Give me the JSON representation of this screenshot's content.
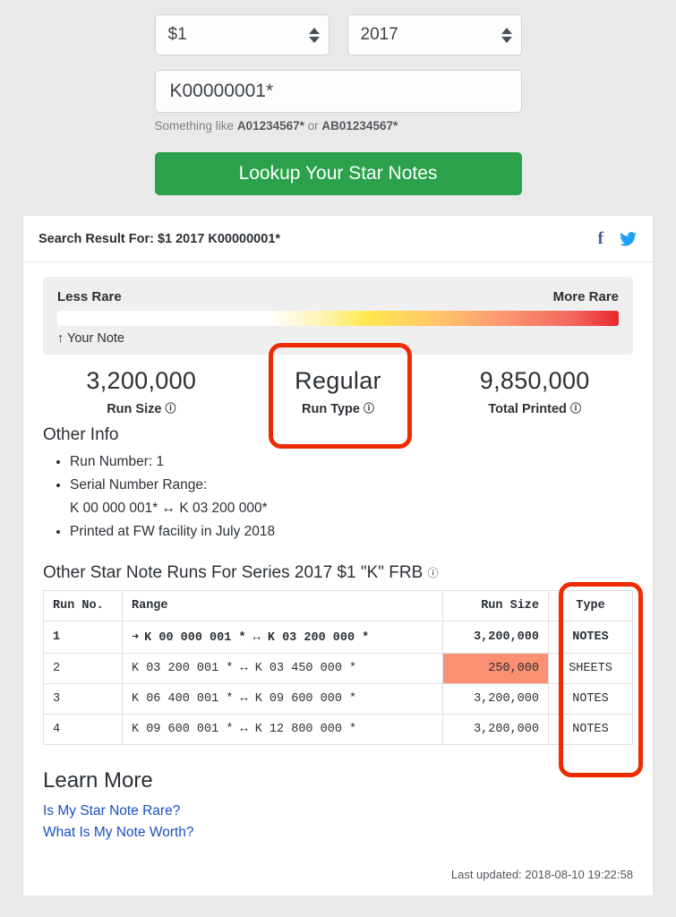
{
  "form": {
    "denomination": "$1",
    "series": "2017",
    "serial_value": "K00000001*",
    "serial_placeholder": "K00000001*",
    "hint_prefix": "Something like ",
    "hint_example_1": "A01234567*",
    "hint_middle": " or ",
    "hint_example_2": "AB01234567*",
    "lookup_label": "Lookup Your Star Notes"
  },
  "result": {
    "header": "Search Result For: $1 2017 K00000001*",
    "facebook_icon": "f",
    "twitter_icon": "ᵕ",
    "meter": {
      "left_label": "Less Rare",
      "right_label": "More Rare",
      "your_note": "↑ Your Note"
    },
    "stats": [
      {
        "value": "3,200,000",
        "label": "Run Size",
        "help": "?"
      },
      {
        "value": "Regular",
        "label": "Run Type",
        "help": "?"
      },
      {
        "value": "9,850,000",
        "label": "Total Printed",
        "help": "?"
      }
    ],
    "other_info": {
      "title": "Other Info",
      "items": [
        "Run Number: 1",
        "Serial Number Range:",
        "K 00 000 001* ↔ K 03 200 000*",
        "Printed at FW facility in July 2018"
      ]
    },
    "table": {
      "title": "Other Star Note Runs For Series 2017 $1 \"K\" FRB",
      "title_help": "?",
      "columns": [
        "Run No.",
        "Range",
        "Run Size",
        "Type"
      ],
      "rows": [
        {
          "run_no": "1",
          "arrow": "➜",
          "range": "K 00 000 001 * ↔ K 03 200 000 *",
          "run_size": "3,200,000",
          "type": "NOTES",
          "current": true,
          "highlight": false
        },
        {
          "run_no": "2",
          "arrow": "",
          "range": "K 03 200 001 * ↔ K 03 450 000 *",
          "run_size": "250,000",
          "type": "SHEETS",
          "current": false,
          "highlight": true
        },
        {
          "run_no": "3",
          "arrow": "",
          "range": "K 06 400 001 * ↔ K 09 600 000 *",
          "run_size": "3,200,000",
          "type": "NOTES",
          "current": false,
          "highlight": false
        },
        {
          "run_no": "4",
          "arrow": "",
          "range": "K 09 600 001 * ↔ K 12 800 000 *",
          "run_size": "3,200,000",
          "type": "NOTES",
          "current": false,
          "highlight": false
        }
      ]
    },
    "learn_more": {
      "title": "Learn More",
      "links": [
        "Is My Star Note Rare?",
        "What Is My Note Worth?"
      ]
    },
    "last_updated": "Last updated: 2018-08-10 19:22:58"
  },
  "colors": {
    "accent_green": "#2aa14a",
    "annotation_red": "#ee2b00",
    "highlight_salmon": "#fa8f72",
    "facebook_blue": "#3b5998",
    "twitter_blue": "#1da1f2",
    "link_blue": "#1a4fc4"
  }
}
